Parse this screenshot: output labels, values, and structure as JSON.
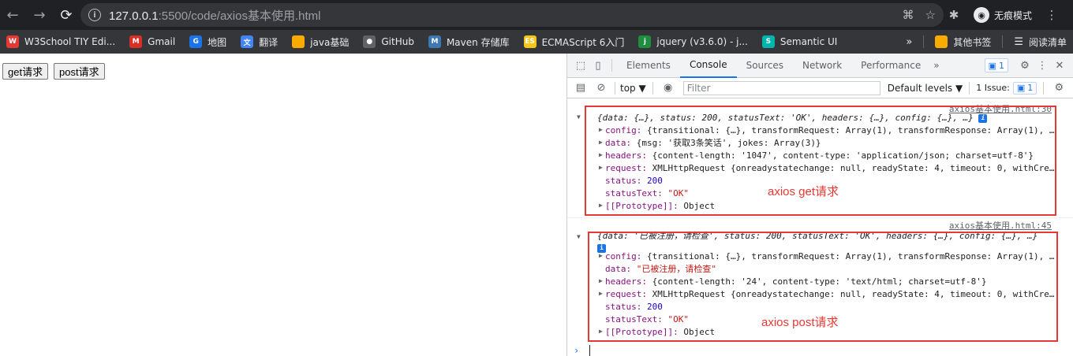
{
  "browser": {
    "url_host": "127.0.0.1",
    "url_rest": ":5500/code/axios基本使用.html",
    "incognito_label": "无痕模式"
  },
  "bookmarks": [
    {
      "label": "W3School TIY Edi...",
      "color": "#e53935",
      "glyph": "W"
    },
    {
      "label": "Gmail",
      "color": "#d93025",
      "glyph": "M"
    },
    {
      "label": "地图",
      "color": "#1a73e8",
      "glyph": "G"
    },
    {
      "label": "翻译",
      "color": "#4285f4",
      "glyph": "文"
    },
    {
      "label": "java基础",
      "color": "#f9ab00",
      "glyph": ""
    },
    {
      "label": "GitHub",
      "color": "#5f6368",
      "glyph": "●"
    },
    {
      "label": "Maven 存储库",
      "color": "#3c78b4",
      "glyph": "M"
    },
    {
      "label": "ECMAScript 6入门",
      "color": "#f5c518",
      "glyph": "ES"
    },
    {
      "label": "jquery (v3.6.0) - j...",
      "color": "#1e8e3e",
      "glyph": "j"
    },
    {
      "label": "Semantic UI",
      "color": "#00b5ad",
      "glyph": "S"
    }
  ],
  "bookmarks_right": {
    "more": "»",
    "other": "其他书签",
    "reading": "阅读清单"
  },
  "page": {
    "get_button": "get请求",
    "post_button": "post请求"
  },
  "devtools": {
    "tabs": [
      "Elements",
      "Console",
      "Sources",
      "Network",
      "Performance"
    ],
    "more_tabs": "»",
    "issues_badge": "1",
    "context": "top ▼",
    "filter_placeholder": "Filter",
    "levels": "Default levels ▼",
    "issue_count": "1 Issue:",
    "issue_badge_count": "1"
  },
  "console": {
    "msg1": {
      "source": "axios基本使用.html:30",
      "summary": "{data: {…}, status: 200, statusText: 'OK', headers: {…}, config: {…}, …}",
      "config": "{transitional: {…}, transformRequest: Array(1), transformResponse: Array(1), …",
      "data": "{msg: '获取3条笑话', jokes: Array(3)}",
      "headers": "{content-length: '1047', content-type: 'application/json; charset=utf-8'}",
      "request": "XMLHttpRequest {onreadystatechange: null, readyState: 4, timeout: 0, withCre…",
      "status": "200",
      "statusText": "\"OK\"",
      "proto": "Object",
      "annotation": "axios get请求"
    },
    "msg2": {
      "source": "axios基本使用.html:45",
      "summary": "{data: '已被注册，请检查', status: 200, statusText: 'OK', headers: {…}, config: {…}, …}",
      "config": "{transitional: {…}, transformRequest: Array(1), transformResponse: Array(1), …",
      "data": "\"已被注册，请检查\"",
      "headers": "{content-length: '24', content-type: 'text/html; charset=utf-8'}",
      "request": "XMLHttpRequest {onreadystatechange: null, readyState: 4, timeout: 0, withCre…",
      "status": "200",
      "statusText": "\"OK\"",
      "proto": "Object",
      "annotation": "axios post请求"
    },
    "prop_labels": {
      "config": "config:",
      "data": "data:",
      "headers": "headers:",
      "request": "request:",
      "status": "status:",
      "statusText": "statusText:",
      "proto": "[[Prototype]]:"
    }
  }
}
